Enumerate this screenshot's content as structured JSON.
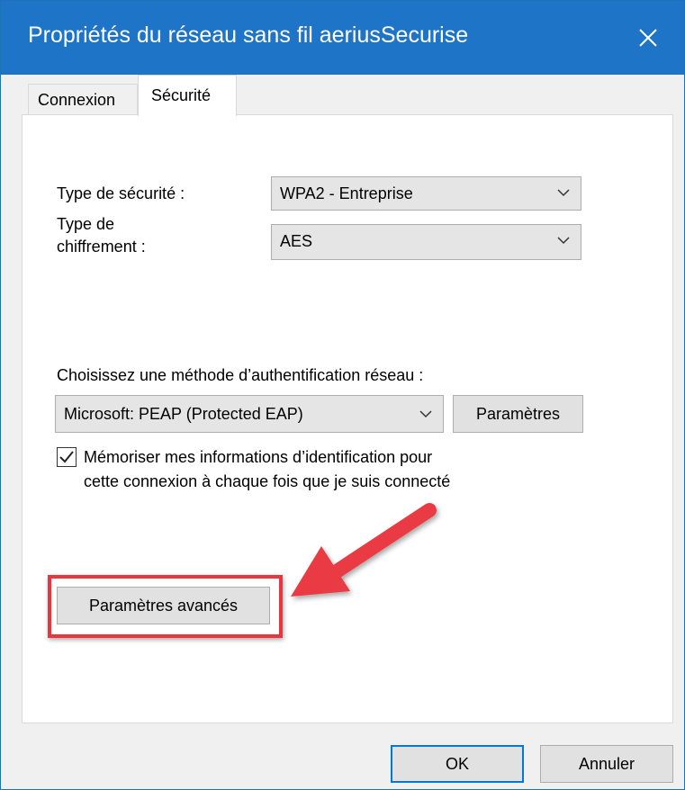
{
  "window": {
    "title": "Propriétés du réseau sans fil aeriusSecurise"
  },
  "tabs": [
    {
      "label": "Connexion",
      "active": false
    },
    {
      "label": "Sécurité",
      "active": true
    }
  ],
  "security": {
    "type_label": "Type de sécurité :",
    "type_value": "WPA2 - Entreprise",
    "encryption_label_line1": "Type de",
    "encryption_label_line2": "chiffrement :",
    "encryption_value": "AES"
  },
  "auth": {
    "label": "Choisissez une méthode d’authentification réseau :",
    "method_value": "Microsoft: PEAP (Protected EAP)",
    "settings_button": "Paramètres",
    "remember_checked": true,
    "remember_line1": "Mémoriser mes informations d’identification pour",
    "remember_line2": "cette connexion à chaque fois que je suis connecté"
  },
  "advanced_button": "Paramètres avancés",
  "footer": {
    "ok_button": "OK",
    "cancel_button": "Annuler"
  },
  "colors": {
    "titlebar": "#1e74c6",
    "highlight": "#e8353e",
    "ok_border": "#0078d7"
  },
  "icons": {
    "close": "close-icon",
    "chevron": "chevron-down-icon",
    "check": "checkmark-icon",
    "arrow": "annotation-arrow"
  }
}
